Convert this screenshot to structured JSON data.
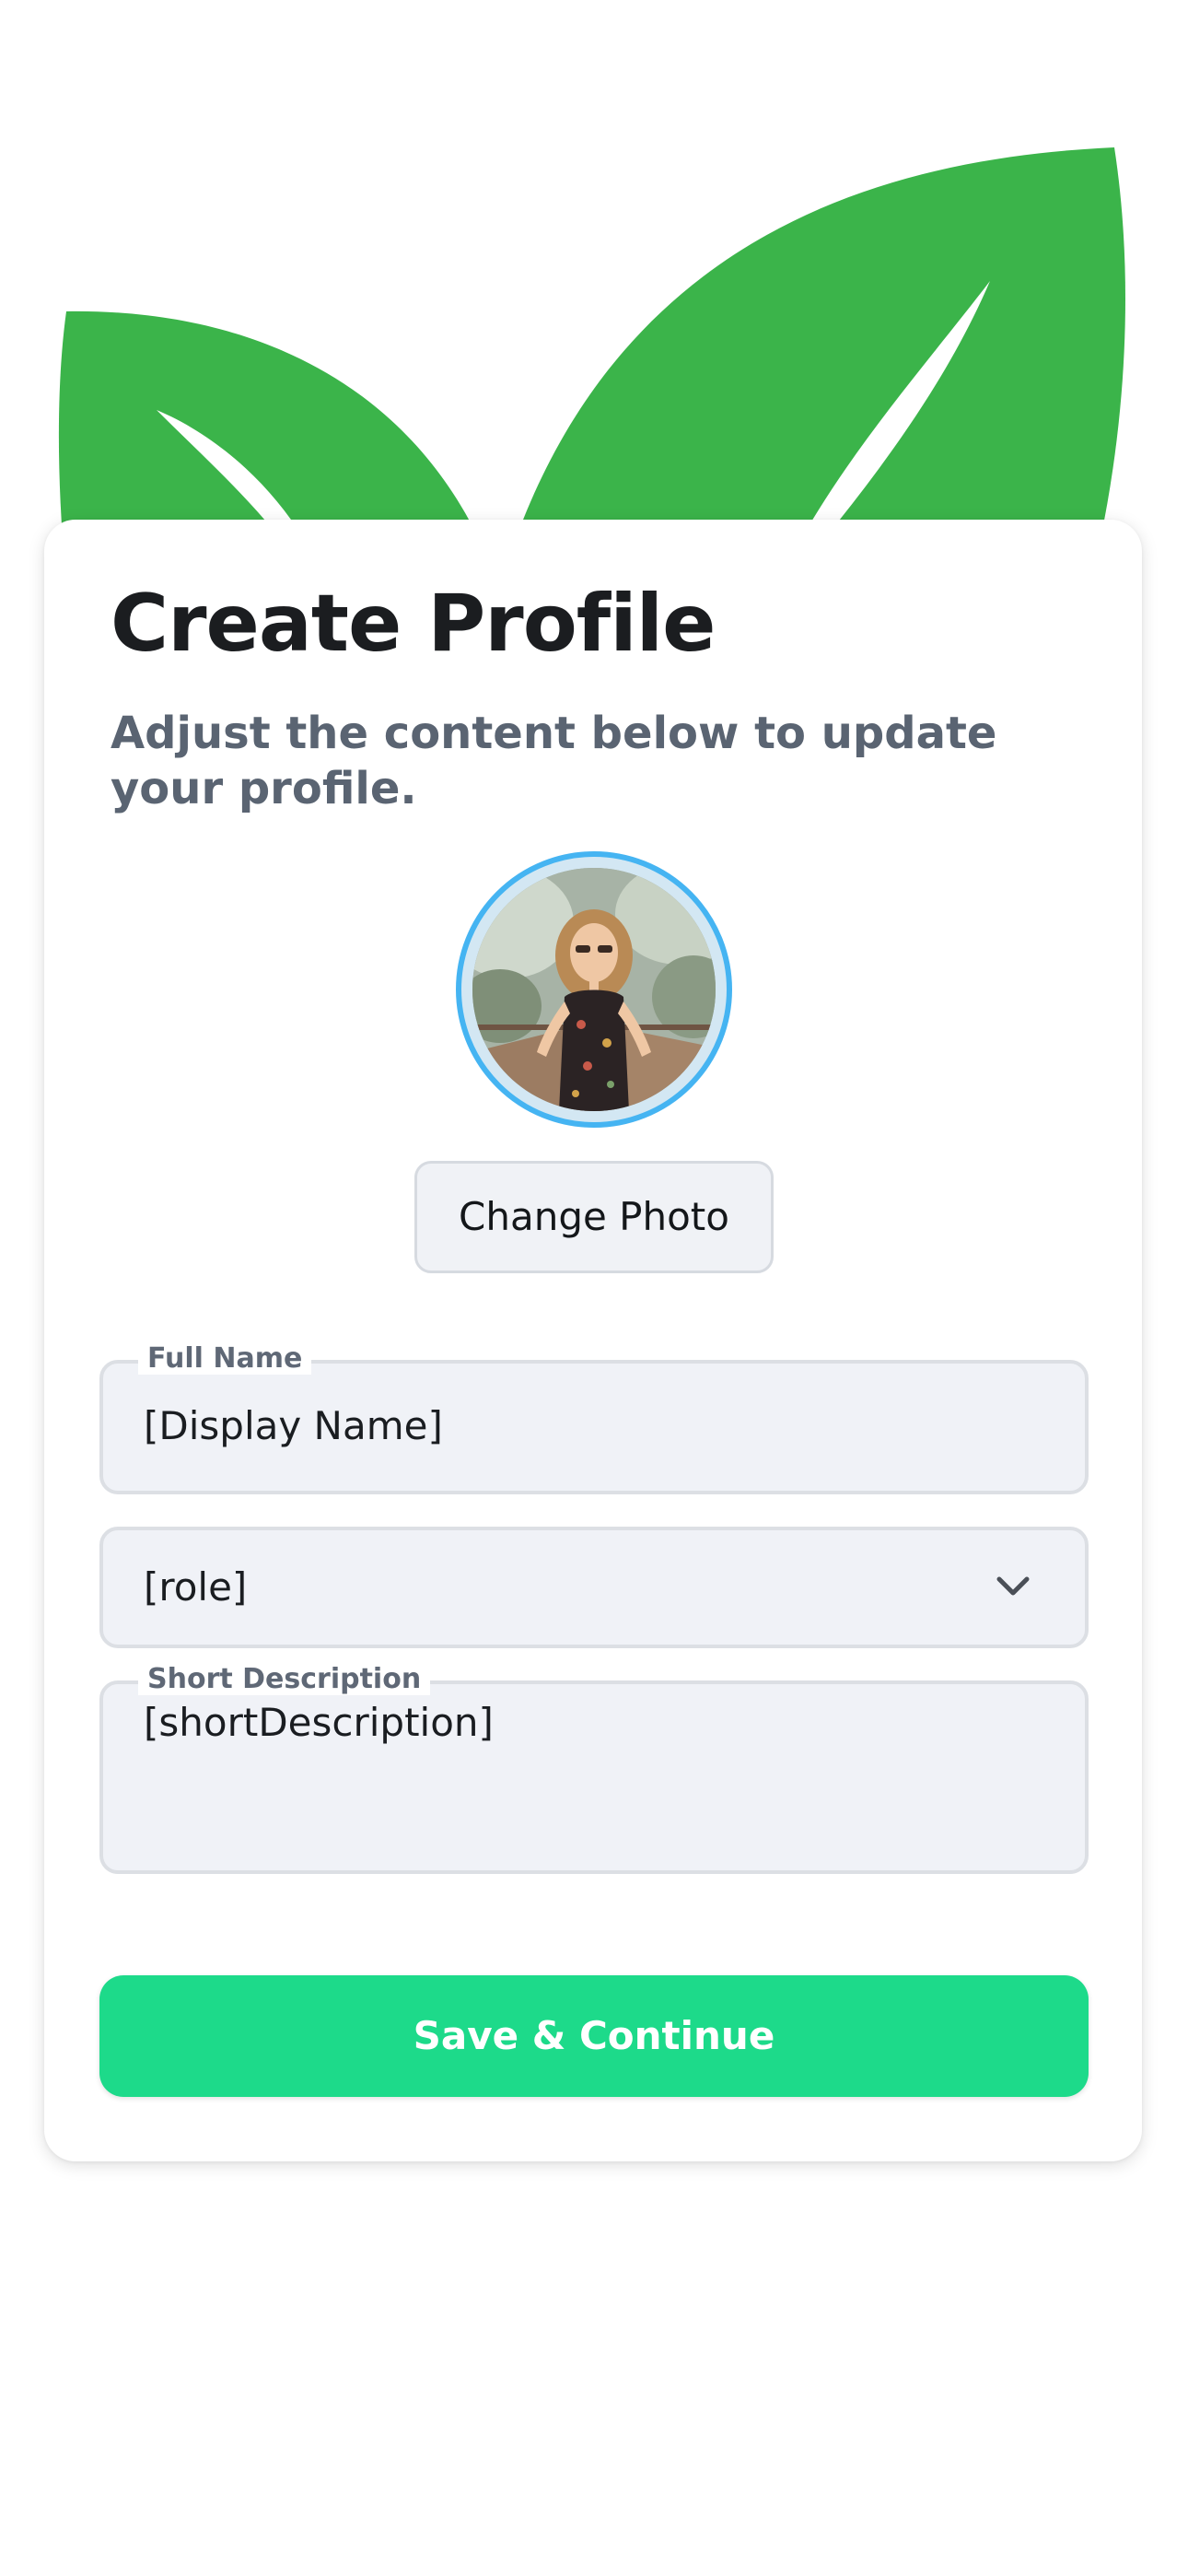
{
  "header": {
    "title": "Create Profile",
    "subtitle": "Adjust the content below to update your profile."
  },
  "profile_photo": {
    "change_label": "Change Photo"
  },
  "form": {
    "full_name": {
      "label": "Full Name",
      "value": "[Display Name]"
    },
    "role": {
      "value": "[role]"
    },
    "short_description": {
      "label": "Short Description",
      "value": "[shortDescription]"
    }
  },
  "actions": {
    "save_label": "Save & Continue"
  },
  "icons": {
    "leaves": "leaf-icon",
    "role_dropdown": "chevron-down-icon"
  },
  "colors": {
    "leaf_green": "#3bb44a",
    "accent_button": "#1dda8a",
    "avatar_ring": "#45b4f2",
    "field_background": "#f0f2f7"
  }
}
